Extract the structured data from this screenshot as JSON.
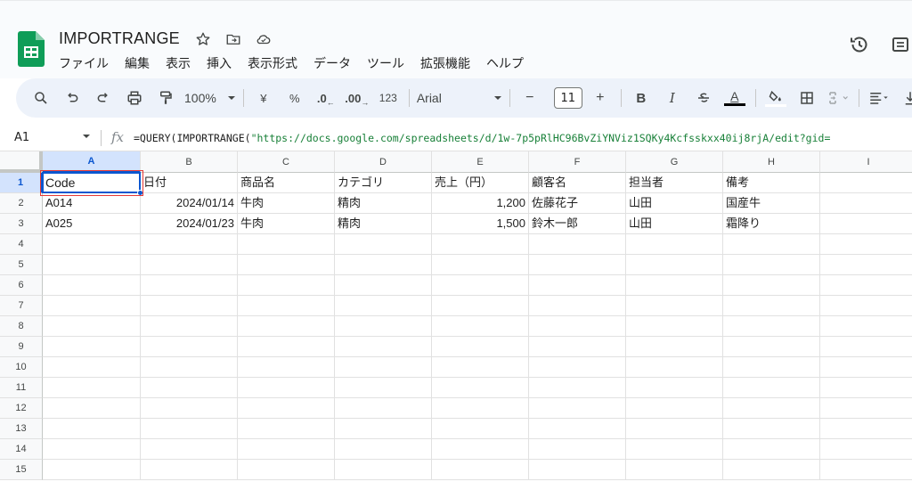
{
  "document": {
    "title": "IMPORTRANGE"
  },
  "menu": [
    "ファイル",
    "編集",
    "表示",
    "挿入",
    "表示形式",
    "データ",
    "ツール",
    "拡張機能",
    "ヘルプ"
  ],
  "title_icons": [
    "star-icon",
    "move-to-folder-icon",
    "cloud-status-icon"
  ],
  "top_right_icons": [
    "version-history-icon",
    "comments-icon"
  ],
  "toolbar": {
    "zoom": "100%",
    "currency": "¥",
    "percent": "%",
    "decrease_decimal": ".0",
    "increase_decimal": ".00",
    "number_format": "123",
    "font_name": "Arial",
    "minus": "−",
    "font_size": "11",
    "plus": "+",
    "bold": "B",
    "italic": "I",
    "text_color": "A"
  },
  "formula_bar": {
    "name_box": "A1",
    "fx": "fx",
    "formula_prefix": "=QUERY(IMPORTRANGE(",
    "formula_string": "\"https://docs.google.com/spreadsheets/d/1w-7p5pRlHC96BvZiYNViz1SQKy4Kcfsskxx40ij8rjA/edit?gid="
  },
  "grid": {
    "columns": [
      "A",
      "B",
      "C",
      "D",
      "E",
      "F",
      "G",
      "H",
      "I"
    ],
    "rows": [
      "1",
      "2",
      "3",
      "4",
      "5",
      "6",
      "7",
      "8",
      "9",
      "10",
      "11",
      "12",
      "13",
      "14",
      "15"
    ],
    "selected_column": "A",
    "selected_row": "1",
    "cells": [
      [
        "Code",
        "日付",
        "商品名",
        "カテゴリ",
        "売上（円）",
        "顧客名",
        "担当者",
        "備考"
      ],
      [
        "A014",
        "2024/01/14",
        "牛肉",
        "精肉",
        "1,200",
        "佐藤花子",
        "山田",
        "国産牛"
      ],
      [
        "A025",
        "2024/01/23",
        "牛肉",
        "精肉",
        "1,500",
        "鈴木一郎",
        "山田",
        "霜降り"
      ]
    ]
  },
  "colors": {
    "accent": "#0b57d0",
    "sheets_green": "#0f9d58",
    "highlight_red": "#e53935",
    "formula_string": "#188038"
  }
}
